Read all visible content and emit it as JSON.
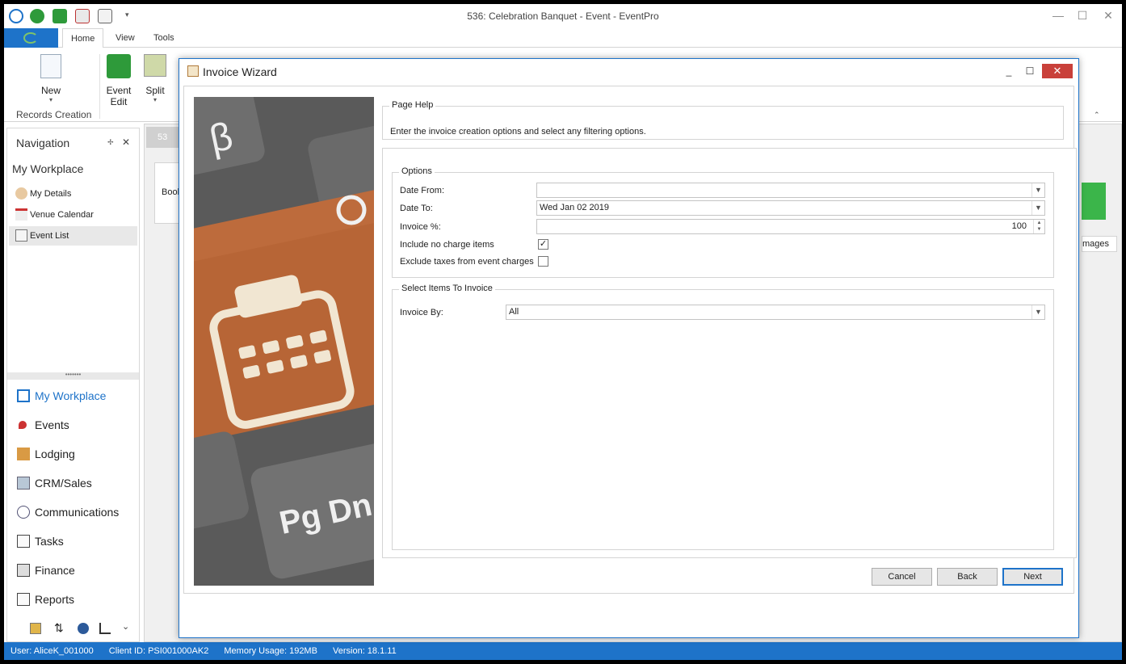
{
  "window": {
    "title": "536: Celebration Banquet - Event - EventPro",
    "min_icon": "minimize-icon",
    "max_icon": "maximize-icon",
    "close_icon": "close-icon"
  },
  "menu": {
    "tabs": [
      "Home",
      "View",
      "Tools"
    ],
    "active_tab": "Home"
  },
  "ribbon": {
    "new_label": "New",
    "event_edit_label": "Event Edit",
    "split_label": "Split",
    "group_records_creation": "Records Creation"
  },
  "nav": {
    "header": "Navigation",
    "section_title": "My Workplace",
    "items": [
      {
        "label": "My Details",
        "icon": "user-icon"
      },
      {
        "label": "Venue Calendar",
        "icon": "calendar-icon"
      },
      {
        "label": "Event List",
        "icon": "list-icon"
      }
    ],
    "modules": [
      {
        "label": "My Workplace",
        "icon": "home-icon",
        "active": true
      },
      {
        "label": "Events",
        "icon": "pushpin-icon"
      },
      {
        "label": "Lodging",
        "icon": "bed-icon"
      },
      {
        "label": "CRM/Sales",
        "icon": "contacts-icon"
      },
      {
        "label": "Communications",
        "icon": "speech-bubble-icon"
      },
      {
        "label": "Tasks",
        "icon": "clipboard-icon"
      },
      {
        "label": "Finance",
        "icon": "calculator-icon"
      },
      {
        "label": "Reports",
        "icon": "report-icon"
      }
    ]
  },
  "background": {
    "tab_label": "53",
    "booking_label": "Book",
    "images_label": "mages"
  },
  "dialog": {
    "title": "Invoice Wizard",
    "page_help_label": "Page Help",
    "page_help_text": "Enter the invoice creation options and select any filtering options.",
    "options_label": "Options",
    "date_from_label": "Date From:",
    "date_from_value": "",
    "date_to_label": "Date To:",
    "date_to_value": "Wed Jan 02 2019",
    "invoice_pct_label": "Invoice %:",
    "invoice_pct_value": "100",
    "include_no_charge_label": "Include no charge items",
    "include_no_charge_checked": "✓",
    "exclude_taxes_label": "Exclude taxes from event charges",
    "exclude_taxes_checked": "",
    "select_items_label": "Select Items To Invoice",
    "invoice_by_label": "Invoice By:",
    "invoice_by_value": "All",
    "cancel_label": "Cancel",
    "back_label": "Back",
    "next_label": "Next"
  },
  "status": {
    "user": "User: AliceK_001000",
    "client_id": "Client ID: PSI001000AK2",
    "memory": "Memory Usage: 192MB",
    "version": "Version: 18.1.11"
  }
}
